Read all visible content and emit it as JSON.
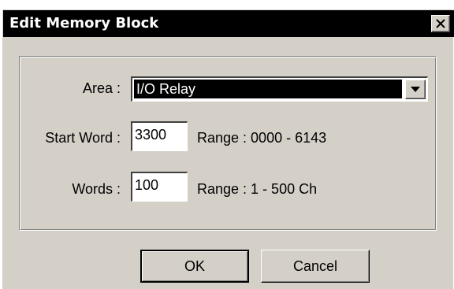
{
  "window": {
    "title": "Edit Memory Block",
    "close_icon": "close-icon"
  },
  "form": {
    "area_label": "Area :",
    "area_value": "I/O Relay",
    "start_word_label": "Start Word :",
    "start_word_value": "3300",
    "start_word_range": "Range : 0000 - 6143",
    "words_label": "Words :",
    "words_value": "100",
    "words_range": "Range : 1 - 500 Ch"
  },
  "buttons": {
    "ok": "OK",
    "cancel": "Cancel"
  },
  "colors": {
    "face": "#d4d0c8",
    "titlebar": "#000000",
    "selection": "#000000"
  }
}
